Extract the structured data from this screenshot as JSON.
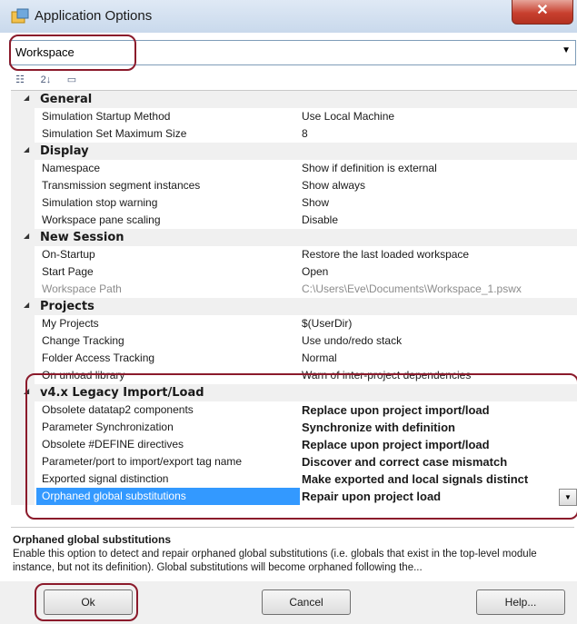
{
  "window": {
    "title": "Application Options",
    "close_glyph": "✕"
  },
  "workspace_select": {
    "value": "Workspace",
    "arrow": "▼"
  },
  "toolbar": {
    "icons": [
      "categorized-icon",
      "alphabetical-sort-icon",
      "property-pages-icon"
    ],
    "glyphs": [
      "☷",
      "2↓",
      "▭"
    ]
  },
  "categories": [
    {
      "name": "General",
      "props": [
        {
          "name": "Simulation Startup Method",
          "value": "Use Local Machine"
        },
        {
          "name": "Simulation Set Maximum Size",
          "value": "8"
        }
      ]
    },
    {
      "name": "Display",
      "props": [
        {
          "name": "Namespace",
          "value": "Show if definition is external"
        },
        {
          "name": "Transmission segment instances",
          "value": "Show always"
        },
        {
          "name": "Simulation stop warning",
          "value": "Show"
        },
        {
          "name": "Workspace pane scaling",
          "value": "Disable"
        }
      ]
    },
    {
      "name": "New Session",
      "props": [
        {
          "name": "On-Startup",
          "value": "Restore the last loaded workspace"
        },
        {
          "name": "Start Page",
          "value": "Open"
        },
        {
          "name": "Workspace Path",
          "value": "C:\\Users\\Eve\\Documents\\Workspace_1.pswx",
          "disabled": true
        }
      ]
    },
    {
      "name": "Projects",
      "props": [
        {
          "name": "My Projects",
          "value": "$(UserDir)"
        },
        {
          "name": "Change Tracking",
          "value": "Use undo/redo stack"
        },
        {
          "name": "Folder Access Tracking",
          "value": "Normal"
        },
        {
          "name": "On unload library",
          "value": "Warn of inter-project dependencies"
        }
      ]
    },
    {
      "name": "v4.x Legacy Import/Load",
      "props": [
        {
          "name": "Obsolete datatap2 components",
          "value": "Replace upon project import/load",
          "bold": true
        },
        {
          "name": "Parameter Synchronization",
          "value": "Synchronize with definition",
          "bold": true
        },
        {
          "name": "Obsolete #DEFINE directives",
          "value": "Replace upon project import/load",
          "bold": true
        },
        {
          "name": "Parameter/port to import/export tag name",
          "value": "Discover and correct case mismatch",
          "bold": true
        },
        {
          "name": "Exported signal distinction",
          "value": "Make exported and local signals distinct",
          "bold": true
        },
        {
          "name": "Orphaned global substitutions",
          "value": "Repair upon project load",
          "bold": true,
          "selected": true
        }
      ]
    }
  ],
  "description": {
    "title": "Orphaned global substitutions",
    "text": "Enable this option to detect and repair orphaned global substitutions (i.e. globals that exist in the top-level module instance, but not its definition). Global substitutions will become orphaned following the..."
  },
  "buttons": {
    "ok": "Ok",
    "cancel": "Cancel",
    "help": "Help..."
  },
  "colors": {
    "selection": "#3399ff",
    "highlight": "#8b1a2b",
    "close": "#c8402f"
  }
}
